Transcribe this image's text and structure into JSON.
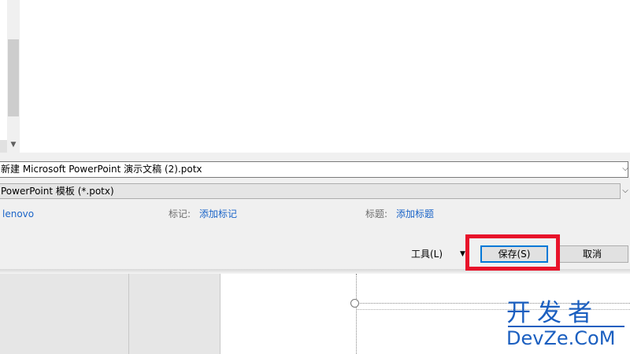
{
  "dialog": {
    "filename": "新建 Microsoft PowerPoint 演示文稿 (2).potx",
    "filetype": "PowerPoint 模板 (*.potx)",
    "author": "lenovo",
    "tags_label": "标记:",
    "tags_link": "添加标记",
    "title_label": "标题:",
    "title_link": "添加标题",
    "tools_label": "工具(L)",
    "save_label": "保存(S)",
    "cancel_label": "取消"
  },
  "icons": {
    "scroll_down": "chevron-down-icon",
    "dropdown": "chevron-down-icon",
    "tools_dropdown": "triangle-down-icon"
  },
  "watermark": {
    "chinese": "开发者",
    "latin": "DevZe.CoM"
  },
  "colors": {
    "link": "#1a64c8",
    "highlight_box": "#e8132a",
    "watermark": "#1b5fc0",
    "save_border": "#0078d7"
  }
}
